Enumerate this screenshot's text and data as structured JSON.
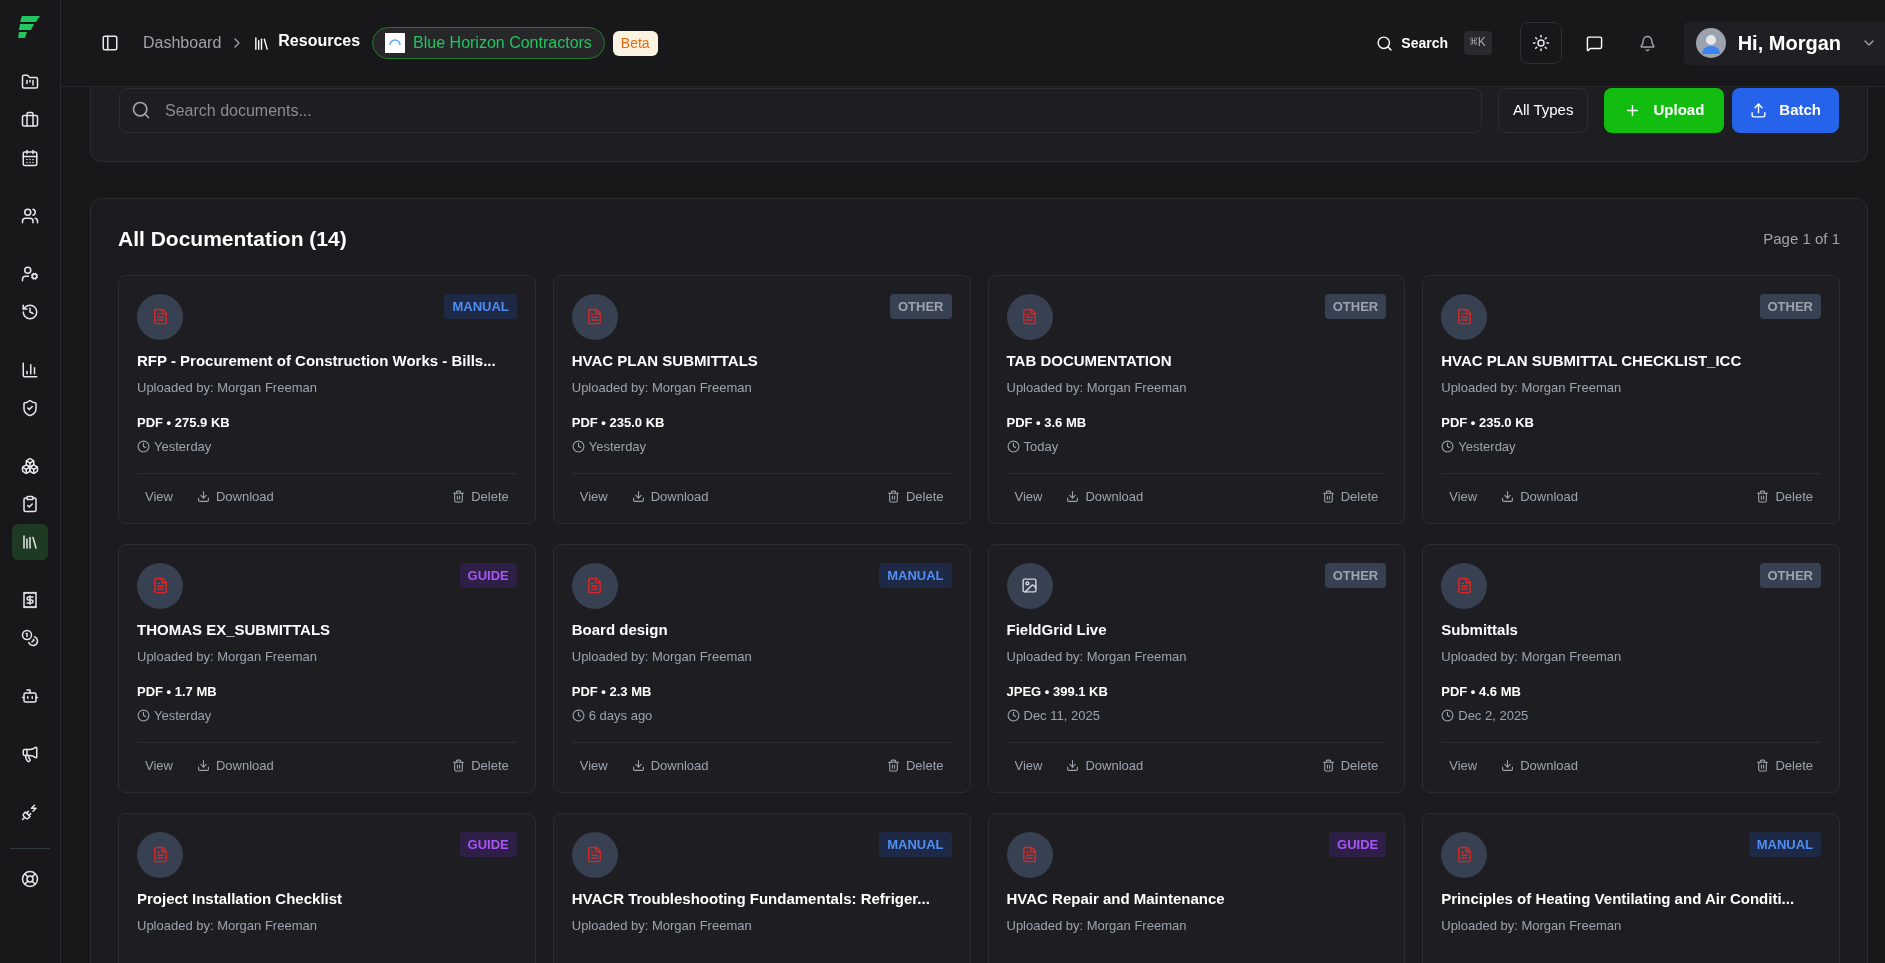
{
  "sidebar": {
    "items": [
      {
        "selected": false
      },
      {
        "selected": false
      },
      {
        "selected": false
      },
      {
        "selected": false
      },
      {
        "selected": false
      },
      {
        "selected": false
      },
      {
        "selected": false
      },
      {
        "selected": false
      },
      {
        "selected": false
      },
      {
        "selected": false
      },
      {
        "selected": true
      },
      {
        "selected": false
      },
      {
        "selected": false
      },
      {
        "selected": false
      },
      {
        "selected": false
      },
      {
        "selected": false
      },
      {
        "selected": false
      }
    ]
  },
  "topbar": {
    "breadcrumb": [
      "Dashboard",
      "Resources"
    ],
    "company": "Blue Horizon Contractors",
    "badge": "Beta",
    "search": "Search",
    "shortcut": "⌘K",
    "greeting": "Hi, Morgan"
  },
  "toolbar": {
    "search": {
      "placeholder": "Search documents..."
    },
    "filter": "All Types",
    "upload": "Upload",
    "batch": "Batch"
  },
  "documents": {
    "title": "All Documentation (14)",
    "page": "Page 1 of 1",
    "cards": [
      {
        "kind": "pdf",
        "tag": {
          "label": "MANUAL",
          "kind": "manual",
          "color": "#1e2a45"
        },
        "title": "RFP - Procurement of Construction Works - Bills...",
        "uploader": "Uploaded by: Morgan Freeman",
        "meta": "PDF • 275.9 KB",
        "date": "Yesterday",
        "actions": [
          "View",
          "Download",
          "Delete"
        ]
      },
      {
        "kind": "pdf",
        "tag": {
          "label": "OTHER",
          "kind": "other",
          "color": "#374151"
        },
        "title": "HVAC PLAN SUBMITTALS",
        "uploader": "Uploaded by: Morgan Freeman",
        "meta": "PDF • 235.0 KB",
        "date": "Yesterday",
        "actions": [
          "View",
          "Download",
          "Delete"
        ]
      },
      {
        "kind": "pdf",
        "tag": {
          "label": "OTHER",
          "kind": "other",
          "color": "#374151"
        },
        "title": "TAB DOCUMENTATION",
        "uploader": "Uploaded by: Morgan Freeman",
        "meta": "PDF • 3.6 MB",
        "date": "Today",
        "actions": [
          "View",
          "Download",
          "Delete"
        ]
      },
      {
        "kind": "pdf",
        "tag": {
          "label": "OTHER",
          "kind": "other",
          "color": "#374151"
        },
        "title": "HVAC PLAN SUBMITTAL CHECKLIST_ICC",
        "uploader": "Uploaded by: Morgan Freeman",
        "meta": "PDF • 235.0 KB",
        "date": "Yesterday",
        "actions": [
          "View",
          "Download",
          "Delete"
        ]
      },
      {
        "kind": "pdf",
        "tag": {
          "label": "GUIDE",
          "kind": "guide",
          "color": "#2e1f47"
        },
        "title": "THOMAS EX_SUBMITTALS",
        "uploader": "Uploaded by: Morgan Freeman",
        "meta": "PDF • 1.7 MB",
        "date": "Yesterday",
        "actions": [
          "View",
          "Download",
          "Delete"
        ]
      },
      {
        "kind": "pdf",
        "tag": {
          "label": "MANUAL",
          "kind": "manual",
          "color": "#1e2a45"
        },
        "title": "Board design",
        "uploader": "Uploaded by: Morgan Freeman",
        "meta": "PDF • 2.3 MB",
        "date": "6 days ago",
        "actions": [
          "View",
          "Download",
          "Delete"
        ]
      },
      {
        "kind": "image",
        "tag": {
          "label": "OTHER",
          "kind": "other",
          "color": "#374151"
        },
        "title": "FieldGrid Live",
        "uploader": "Uploaded by: Morgan Freeman",
        "meta": "JPEG • 399.1 KB",
        "date": "Dec 11, 2025",
        "actions": [
          "View",
          "Download",
          "Delete"
        ]
      },
      {
        "kind": "pdf",
        "tag": {
          "label": "OTHER",
          "kind": "other",
          "color": "#374151"
        },
        "title": "Submittals",
        "uploader": "Uploaded by: Morgan Freeman",
        "meta": "PDF • 4.6 MB",
        "date": "Dec 2, 2025",
        "actions": [
          "View",
          "Download",
          "Delete"
        ]
      },
      {
        "kind": "pdf",
        "tag": {
          "label": "GUIDE",
          "kind": "guide",
          "color": "#2e1f47"
        },
        "title": "Project Installation Checklist",
        "uploader": "Uploaded by: Morgan Freeman"
      },
      {
        "kind": "pdf",
        "tag": {
          "label": "MANUAL",
          "kind": "manual",
          "color": "#1e2a45"
        },
        "title": "HVACR Troubleshooting Fundamentals: Refriger...",
        "uploader": "Uploaded by: Morgan Freeman"
      },
      {
        "kind": "pdf",
        "tag": {
          "label": "GUIDE",
          "kind": "guide",
          "color": "#2e1f47"
        },
        "title": "HVAC Repair and Maintenance",
        "uploader": "Uploaded by: Morgan Freeman"
      },
      {
        "kind": "pdf",
        "tag": {
          "label": "MANUAL",
          "kind": "manual",
          "color": "#1e2a45"
        },
        "title": "Principles of Heating Ventilating and Air Conditi...",
        "uploader": "Uploaded by: Morgan Freeman"
      }
    ]
  }
}
